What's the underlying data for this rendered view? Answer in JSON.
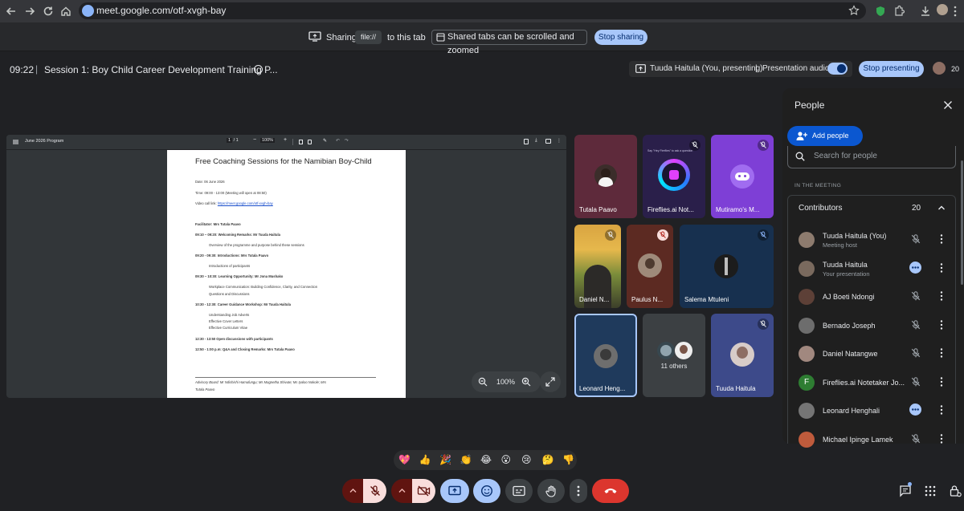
{
  "browser": {
    "url": "meet.google.com/otf-xvgh-bay"
  },
  "share_bar": {
    "sharing_label": "Sharing",
    "file_label": "file://",
    "to_tab_label": "to this tab",
    "scroll_note": "Shared tabs can be scrolled and zoomed",
    "stop_sharing_label": "Stop sharing"
  },
  "header": {
    "time": "09:22",
    "separator": "|",
    "title": "Session 1: Boy Child Career Development Training P...",
    "presenting_label": "Tuuda Haitula (You, presenting)",
    "presenting_sep": "|",
    "presentation_audio_label": "Presentation audio",
    "stop_presenting_label": "Stop presenting",
    "participant_count": "20"
  },
  "presentation": {
    "file_name": "June 2026 Program",
    "page_current": "1",
    "page_sep": "/",
    "page_total": "1",
    "zoom_toolbar": "100%",
    "zoom_overlay": "100%",
    "document": {
      "title": "Free Coaching Sessions for the Namibian Boy-Child",
      "date": "Date: 06 June 2026",
      "time": "Time: 09:00 - 13:00 (Meeting will open at 08:50)",
      "video_label": "Video call link: ",
      "video_link": "https://meet.google.com/otf-xvgh-bay",
      "facilitator": "Facilitator: Mrs Tutala Paavo",
      "s1": "09:10 – 09:20: Welcoming Remarks:  Mr Tuuda Haitula",
      "s1b1": "Overview of the programme and purpose behind these sessions",
      "s2": "09:20 - 09:30:  Introductions: Mrs Tutala Paavo",
      "s2b1": "Introductions of participants",
      "s3": "09:30 – 10:30: Learning Opportunity: Mr Jona Mushako",
      "s3b1": "Workplace Communication: Building Confidence, Clarity, and Connection",
      "s3b2": "Questions and Discussions",
      "s4": "10:30 - 12:30: Career Guidance Workshop: Mr Tuuda Haitula",
      "s4b1": "Understanding Job Adverts",
      "s4b2": "Effective Cover Letters",
      "s4b3": "Effective Curriculum Vitae",
      "s5": "12:30 - 13:50 Open discussions with participants",
      "s6": "12:50 - 1:00 p.m: Q&A and Closing Remarks: Mrs Tutala Paavo",
      "advisory": "Advisory Board: Mr Ndishishi Hamufungu; Ms Magnetha Shivute; Ms Iyaloo Nokole; Mrs",
      "advisory2": "Tutala Paavo"
    }
  },
  "tiles": [
    {
      "name": "Tutala Paavo"
    },
    {
      "name": "Fireflies.ai Not...",
      "caption": "Say \"Hey Fireflies\" to ask a question"
    },
    {
      "name": "Mutiramo's M..."
    },
    {
      "name": "Daniel N..."
    },
    {
      "name": "Paulus N..."
    },
    {
      "name": "Salema Mtuleni"
    },
    {
      "name": "Leonard Heng..."
    },
    {
      "name": "11 others"
    },
    {
      "name": "Tuuda Haitula"
    }
  ],
  "people_panel": {
    "title": "People",
    "add_people_label": "Add people",
    "search_placeholder": "Search for people",
    "section_label": "IN THE MEETING",
    "contributors_label": "Contributors",
    "contributors_count": "20",
    "participants": [
      {
        "name": "Tuuda Haitula (You)",
        "sub": "Meeting host",
        "status": "muted",
        "avatar_color": "#8d7b6e"
      },
      {
        "name": "Tuuda Haitula",
        "sub": "Your presentation",
        "status": "presenting",
        "avatar_color": "#7a6a5e"
      },
      {
        "name": "AJ Boeti Ndongi",
        "sub": "",
        "status": "muted",
        "avatar_color": "#5d4037"
      },
      {
        "name": "Bernado Joseph",
        "sub": "",
        "status": "muted",
        "avatar_color": "#6d6d6d"
      },
      {
        "name": "Daniel Natangwe",
        "sub": "",
        "status": "muted",
        "avatar_color": "#a1887f"
      },
      {
        "name": "Fireflies.ai Notetaker Jo...",
        "sub": "",
        "status": "muted",
        "avatar_letter": "F",
        "avatar_color": "#2e7d32"
      },
      {
        "name": "Leonard Henghali",
        "sub": "",
        "status": "speaking",
        "avatar_color": "#757575"
      },
      {
        "name": "Michael Ipinge Lamek",
        "sub": "",
        "status": "muted",
        "avatar_color": "#bf5b3c"
      }
    ]
  },
  "reactions": [
    "💖",
    "👍",
    "🎉",
    "👏",
    "😂",
    "😮",
    "😢",
    "🤔",
    "👎"
  ],
  "colors": {
    "accent": "#a8c7fa",
    "hangup": "#dc362e",
    "mic_off_bg": "#f9dedc",
    "add_people_bg": "#0b57d0"
  }
}
